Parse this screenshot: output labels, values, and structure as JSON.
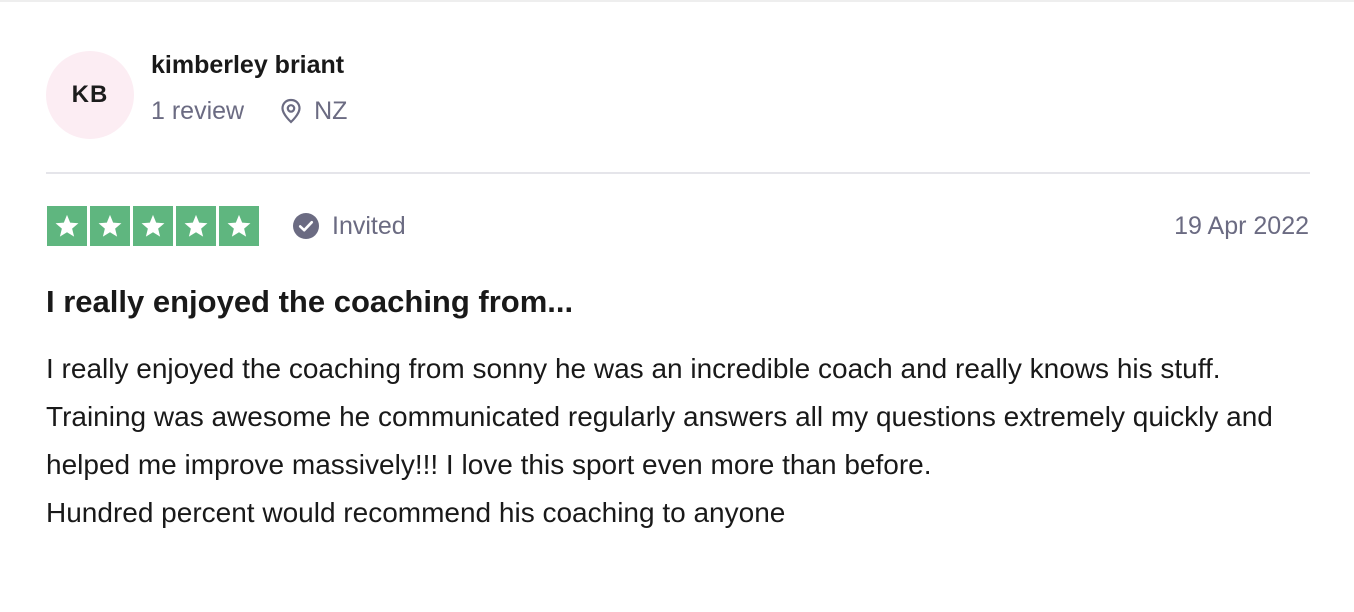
{
  "consumer": {
    "initials": "KB",
    "name": "kimberley briant",
    "review_count": "1 review",
    "location": "NZ",
    "location_icon": "map-pin-icon",
    "avatar_color": "#fcedf3"
  },
  "review": {
    "rating": 5,
    "rating_max": 5,
    "star_color": "#5fb67f",
    "badge_label": "Invited",
    "badge_icon": "checkmark-circle-icon",
    "date": "19 Apr 2022",
    "title": "I really enjoyed the coaching from...",
    "body_paragraph_1": "I really enjoyed the coaching from sonny he was an incredible coach and really knows his stuff. Training was awesome he communicated regularly answers all my questions extremely quickly and helped me improve massively!!! I love this sport even more than before.",
    "body_paragraph_2": "Hundred percent would recommend his coaching to anyone"
  }
}
